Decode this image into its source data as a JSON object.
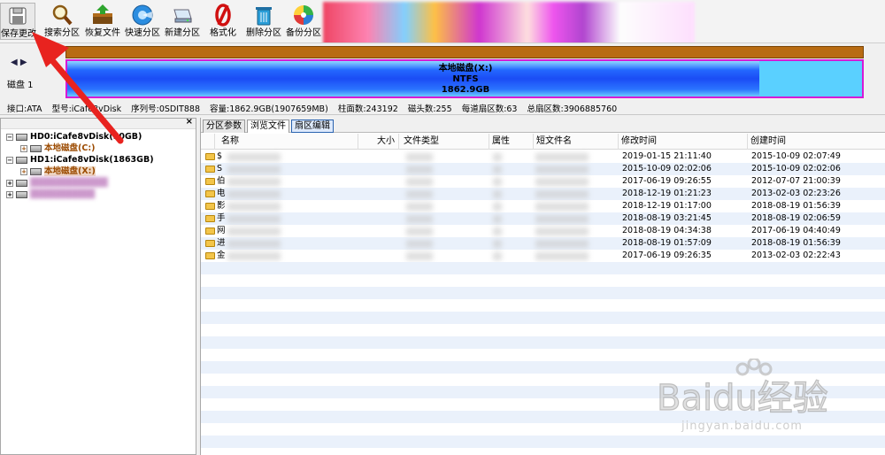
{
  "toolbar": {
    "buttons": [
      {
        "label": "保存更改"
      },
      {
        "label": "搜索分区"
      },
      {
        "label": "恢复文件"
      },
      {
        "label": "快速分区"
      },
      {
        "label": "新建分区"
      },
      {
        "label": "格式化"
      },
      {
        "label": "删除分区"
      },
      {
        "label": "备份分区"
      }
    ]
  },
  "disk_panel": {
    "disk_label": "磁盘 1",
    "partition": {
      "name": "本地磁盘(X:)",
      "fs": "NTFS",
      "size": "1862.9GB"
    }
  },
  "info_line": {
    "interface": "接口:ATA",
    "model": "型号:iCafe8vDisk",
    "serial": "序列号:0SDIT888",
    "capacity": "容量:1862.9GB(1907659MB)",
    "cylinders": "柱面数:243192",
    "heads": "磁头数:255",
    "sectors_per_track": "每道扇区数:63",
    "total_sectors": "总扇区数:3906885760"
  },
  "tree": {
    "items": [
      {
        "label": "HD0:iCafe8vDisk(50GB)"
      },
      {
        "label": "本地磁盘(C:)"
      },
      {
        "label": "HD1:iCafe8vDisk(1863GB)"
      },
      {
        "label": "本地磁盘(X:)"
      }
    ]
  },
  "tabs": [
    {
      "label": "分区参数"
    },
    {
      "label": "浏览文件"
    },
    {
      "label": "扇区编辑"
    }
  ],
  "file_table": {
    "columns": [
      "名称",
      "大小",
      "文件类型",
      "属性",
      "短文件名",
      "修改时间",
      "创建时间"
    ],
    "rows": [
      {
        "name": "$",
        "modified": "2019-01-15 21:11:40",
        "created": "2015-10-09 02:07:49"
      },
      {
        "name": "S",
        "modified": "2015-10-09 02:02:06",
        "created": "2015-10-09 02:02:06"
      },
      {
        "name": "伯",
        "modified": "2017-06-19 09:26:55",
        "created": "2012-07-07 21:00:39"
      },
      {
        "name": "电",
        "modified": "2018-12-19 01:21:23",
        "created": "2013-02-03 02:23:26"
      },
      {
        "name": "影",
        "modified": "2018-12-19 01:17:00",
        "created": "2018-08-19 01:56:39"
      },
      {
        "name": "手",
        "modified": "2018-08-19 03:21:45",
        "created": "2018-08-19 02:06:59"
      },
      {
        "name": "网",
        "modified": "2018-08-19 04:34:38",
        "created": "2017-06-19 04:40:49"
      },
      {
        "name": "进",
        "modified": "2018-08-19 01:57:09",
        "created": "2018-08-19 01:56:39"
      },
      {
        "name": "金",
        "modified": "2017-06-19 09:26:35",
        "created": "2013-02-03 02:22:43"
      }
    ]
  },
  "watermark": {
    "brand": "Baidu经验",
    "url": "jingyan.baidu.com"
  }
}
